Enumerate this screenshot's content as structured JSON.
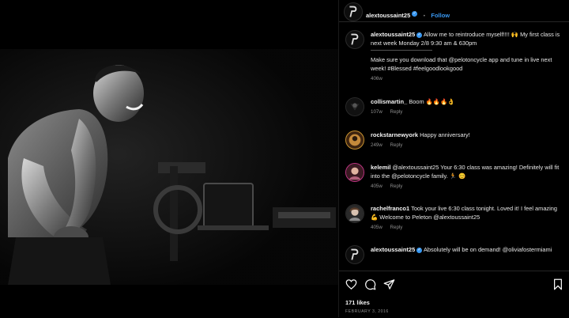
{
  "header": {
    "username": "alextoussaint25",
    "separator": "•",
    "follow_label": "Follow"
  },
  "caption": {
    "username": "alextoussaint25",
    "text1": "Allow me to reintroduce myself!!!! 🙌 My first class is next week Monday 2/8 9:30 am & 630pm",
    "divider": "—————————————",
    "text2": "Make sure you download that @pelotoncycle app and tune in live next week! #Blessed #feelgoodlookgood",
    "time": "406w"
  },
  "comments": [
    {
      "username": "collismartin_",
      "text": "Boom 🔥🔥🔥👌",
      "time": "107w",
      "reply": "Reply"
    },
    {
      "username": "rockstarnewyork",
      "text": "Happy anniversary!",
      "time": "249w",
      "reply": "Reply"
    },
    {
      "username": "kelemil",
      "text": "@alextoussaint25 Your 6:30 class was amazing! Definitely will fit into the @pelotoncycle family. 🏃 😊",
      "time": "405w",
      "reply": "Reply"
    },
    {
      "username": "rachelfranco1",
      "text": "Took your live 6:30 class tonight. Loved it! I feel amazing 💪 Welcome to Peleton @alextoussaint25",
      "time": "405w",
      "reply": "Reply"
    },
    {
      "username": "alextoussaint25",
      "text": "Absolutely will be on demand! @oliviafostermiami",
      "time": "",
      "reply": ""
    }
  ],
  "actions": {
    "likes": "171 likes",
    "date": "FEBRUARY 3, 2016"
  },
  "icons": [
    "peloton-logo-icon",
    "verified-badge-icon",
    "heart-icon",
    "comment-icon",
    "share-icon",
    "bookmark-icon"
  ],
  "colors": {
    "link": "#3897f0",
    "verified": "#3897f0",
    "muted": "#8e8e8e"
  }
}
